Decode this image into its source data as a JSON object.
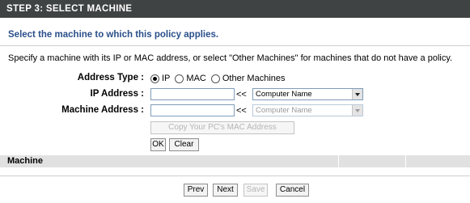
{
  "header": {
    "title": "STEP 3: SELECT MACHINE"
  },
  "subtitle": "Select the machine to which this policy applies.",
  "description": "Specify a machine with its IP or MAC address, or select \"Other Machines\" for machines that do not have a policy.",
  "address_type": {
    "label": "Address Type :",
    "options": [
      {
        "label": "IP",
        "checked": true
      },
      {
        "label": "MAC",
        "checked": false
      },
      {
        "label": "Other Machines",
        "checked": false
      }
    ]
  },
  "ip_address": {
    "label": "IP Address :",
    "value": "",
    "arrows": "<<",
    "select_value": "Computer Name"
  },
  "machine_address": {
    "label": "Machine Address :",
    "value": "",
    "arrows": "<<",
    "select_value": "Computer Name"
  },
  "copy_mac_button": "Copy Your PC's MAC Address",
  "ok_button": "OK",
  "clear_button": "Clear",
  "table": {
    "column_header": "Machine"
  },
  "footer": {
    "prev": "Prev",
    "next": "Next",
    "save": "Save",
    "cancel": "Cancel"
  }
}
